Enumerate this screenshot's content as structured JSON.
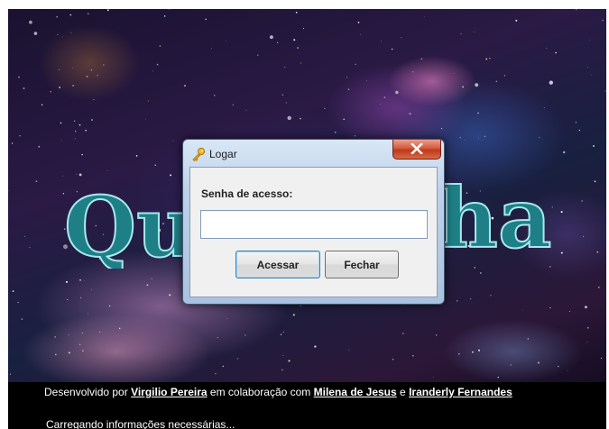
{
  "splash": {
    "logo_left": "Qu",
    "logo_right": "ha",
    "credits": {
      "prefix": "Desenvolvido por",
      "author": "Virgilio Pereira",
      "middle": "em colaboração com",
      "collaborator1": "Milena de Jesus",
      "conjunction": "e",
      "collaborator2": "Iranderly Fernandes"
    },
    "status": "Carregando informações necessárias..."
  },
  "dialog": {
    "title": "Logar",
    "title_icon": "key-icon",
    "close_icon": "close-icon",
    "password_label": "Senha de acesso:",
    "password_value": "",
    "submit_label": "Acessar",
    "close_label": "Fechar"
  },
  "colors": {
    "logo_fill": "#1e7f86",
    "close_button": "#c0381c",
    "dialog_frame": "#bed3ea"
  }
}
